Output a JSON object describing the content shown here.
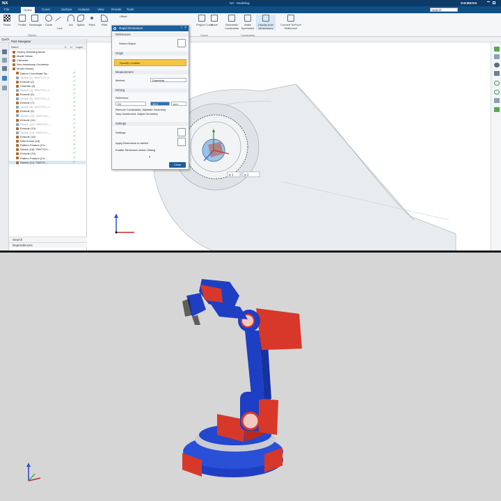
{
  "app": {
    "logo": "NX",
    "title_center": "NX - Modeling",
    "brand": "SIEMENS",
    "search_value": "search"
  },
  "ribbon": {
    "tabs": [
      "File",
      "Home",
      "Curve",
      "Surface",
      "Analysis",
      "View",
      "Render",
      "Tools"
    ],
    "active_tab": "Home",
    "buttons": [
      {
        "label": "Finish"
      },
      {
        "label": "Profile"
      },
      {
        "label": "Rectangle"
      },
      {
        "label": "Circle"
      },
      {
        "label": "Line"
      },
      {
        "label": "Arc"
      },
      {
        "label": "Spline"
      },
      {
        "label": "Point"
      },
      {
        "label": "Fillet"
      },
      {
        "label": "Offset"
      },
      {
        "label": "Project Curve"
      },
      {
        "label": "Move"
      },
      {
        "label": "Geometric Constraints"
      },
      {
        "label": "Make Symmetric"
      },
      {
        "label": "Display Auto Dimensions"
      },
      {
        "label": "Convert To/From Reference"
      }
    ],
    "groups": [
      "Sketch",
      "Curve",
      "Constraints"
    ],
    "command_finder": "Quick"
  },
  "navigator": {
    "title": "Part Navigator",
    "columns": [
      "Name",
      "C",
      "U",
      "Layer"
    ],
    "rows": [
      {
        "label": "History Modeling Mode",
        "indent": 1,
        "chk": false,
        "gray": false
      },
      {
        "label": "Model Views",
        "indent": 1,
        "chk": false,
        "gray": false
      },
      {
        "label": "Cameras",
        "indent": 1,
        "chk": false,
        "gray": false
      },
      {
        "label": "Non-timestamp Geometry",
        "indent": 1,
        "chk": false,
        "gray": false
      },
      {
        "label": "Model History",
        "indent": 1,
        "chk": false,
        "gray": false
      },
      {
        "label": "Datum Coordinate Sy...",
        "indent": 2,
        "chk": true,
        "gray": false
      },
      {
        "label": "Sketch (1) \"SKETCH_0...",
        "indent": 2,
        "chk": true,
        "gray": true
      },
      {
        "label": "Extrude (2)",
        "indent": 2,
        "chk": true,
        "gray": false
      },
      {
        "label": "Chamfer (3)",
        "indent": 2,
        "chk": true,
        "gray": false
      },
      {
        "label": "Sketch (4) \"SKETCH_0...",
        "indent": 2,
        "chk": true,
        "gray": true
      },
      {
        "label": "Extrude (5)",
        "indent": 2,
        "chk": true,
        "gray": false
      },
      {
        "label": "Sketch (6) \"SKETCH_0...",
        "indent": 2,
        "chk": true,
        "gray": true
      },
      {
        "label": "Extrude (7)",
        "indent": 2,
        "chk": true,
        "gray": false
      },
      {
        "label": "Sketch (8) \"SKETCH_0...",
        "indent": 2,
        "chk": true,
        "gray": true
      },
      {
        "label": "Extrude (9)",
        "indent": 2,
        "chk": true,
        "gray": false
      },
      {
        "label": "Sketch (10) \"SKETCH_...",
        "indent": 2,
        "chk": true,
        "gray": true
      },
      {
        "label": "Extrude (11)",
        "indent": 2,
        "chk": true,
        "gray": false
      },
      {
        "label": "Sketch (12) \"SKETCH_...",
        "indent": 2,
        "chk": true,
        "gray": true
      },
      {
        "label": "Extrude (13)",
        "indent": 2,
        "chk": true,
        "gray": false
      },
      {
        "label": "Sketch (14) \"SKETCH_...",
        "indent": 2,
        "chk": true,
        "gray": true
      },
      {
        "label": "Extrude (15)",
        "indent": 2,
        "chk": true,
        "gray": false
      },
      {
        "label": "Datum Axis (16)",
        "indent": 2,
        "chk": true,
        "gray": false
      },
      {
        "label": "Pattern Feature [Cir...",
        "indent": 2,
        "chk": true,
        "gray": false
      },
      {
        "label": "Sketch (18) \"SKETCH...",
        "indent": 2,
        "chk": true,
        "gray": false
      },
      {
        "label": "Extrude (19)",
        "indent": 2,
        "chk": true,
        "gray": false
      },
      {
        "label": "Pattern Feature [Cir...",
        "indent": 2,
        "chk": true,
        "gray": false
      },
      {
        "label": "Sketch (21) \"SKETC...",
        "indent": 2,
        "chk": true,
        "gray": false,
        "sel": true
      }
    ],
    "footer": [
      "Search",
      "Dependencies"
    ]
  },
  "dialog": {
    "title": "Rapid Dimension",
    "sections": [
      "References",
      "Origin",
      "Measurement",
      "Driving",
      "Settings"
    ],
    "select_object": "Select Object",
    "specify_location": "Specify Location",
    "method_label": "Method",
    "method_value": "Diametral",
    "reference_label": "Reference",
    "value_field": "D1",
    "value_highlight": "38.5",
    "units": "mm",
    "opt1": "Remove Constraints, Maintain Geometry",
    "opt2": "Vary Unselected, Adjust Geometry",
    "settings_label": "Settings",
    "apply_dims": "Apply Dimension to sketch",
    "enable_dims": "Enable Dimension Action Dialog",
    "ok_label": "Close"
  },
  "viewport": {
    "dim_input": "⌀ 1",
    "dim_input2": "⌀ 2"
  },
  "colors": {
    "titlebar": "#0d3b66",
    "ribbon_tabs": "#0f4f86",
    "highlight": "#f5c542",
    "robot_blue": "#1e3fc4",
    "robot_red": "#d8382a",
    "check": "#2ea043"
  }
}
